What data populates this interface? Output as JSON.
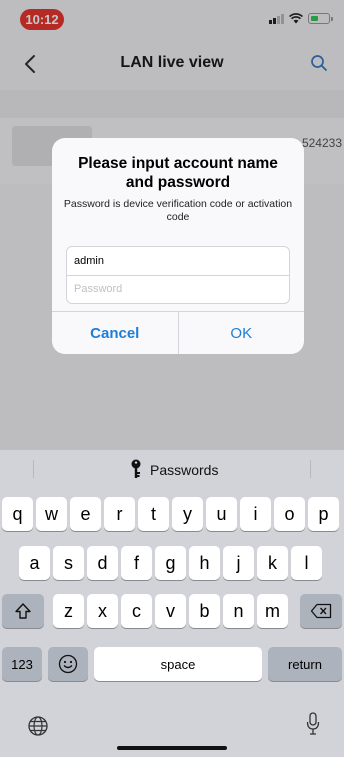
{
  "status_bar": {
    "time": "10:12"
  },
  "nav": {
    "title": "LAN live view"
  },
  "device": {
    "id_partial": "524233"
  },
  "alert": {
    "title": "Please input account name and password",
    "message": "Password is device verification code or activation code",
    "username_value": "admin",
    "password_placeholder": "Password",
    "cancel_label": "Cancel",
    "ok_label": "OK"
  },
  "keyboard": {
    "suggestion": "Passwords",
    "row1": [
      "q",
      "w",
      "e",
      "r",
      "t",
      "y",
      "u",
      "i",
      "o",
      "p"
    ],
    "row2": [
      "a",
      "s",
      "d",
      "f",
      "g",
      "h",
      "j",
      "k",
      "l"
    ],
    "row3": [
      "z",
      "x",
      "c",
      "v",
      "b",
      "n",
      "m"
    ],
    "numbers_label": "123",
    "space_label": "space",
    "return_label": "return"
  },
  "colors": {
    "accent": "#1d7ed8",
    "time_pill": "#e8372f",
    "keyboard_bg": "#d1d3d9"
  },
  "icons": [
    "back-chevron",
    "search",
    "key",
    "shift",
    "delete",
    "emoji",
    "globe",
    "microphone"
  ]
}
